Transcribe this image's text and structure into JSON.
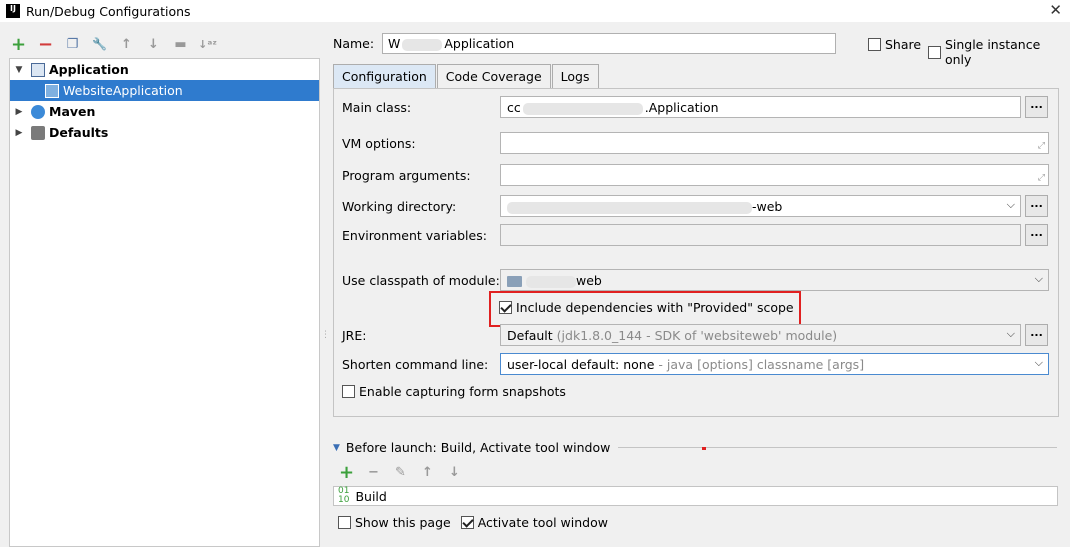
{
  "window": {
    "title": "Run/Debug Configurations",
    "app_icon_text": "IJ",
    "close_glyph": "✕"
  },
  "left_toolbar": {
    "add": "+",
    "remove": "−",
    "copy": "❐",
    "edit_defaults": "🔧",
    "move_up": "↑",
    "move_down": "↓",
    "folder": "▬",
    "sort": "↓ᵃᶻ"
  },
  "tree": {
    "items": [
      {
        "label": "Application",
        "expanded": true
      },
      {
        "label": "WebsiteApplication",
        "selected": true
      },
      {
        "label": "Maven",
        "expanded": false
      },
      {
        "label": "Defaults",
        "expanded": false
      }
    ]
  },
  "header": {
    "name_label": "Name:",
    "name_prefix": "W",
    "name_suffix": "Application",
    "share_label": "Share",
    "single_instance_label": "Single instance only"
  },
  "tabs": [
    {
      "label": "Configuration",
      "active": true
    },
    {
      "label": "Code Coverage"
    },
    {
      "label": "Logs"
    }
  ],
  "config": {
    "main_class_label": "Main class:",
    "main_class_prefix": "cc",
    "main_class_suffix": ".Application",
    "vm_options_label": "VM options:",
    "program_args_label": "Program arguments:",
    "working_dir_label": "Working directory:",
    "working_dir_suffix": "-web",
    "env_vars_label": "Environment variables:",
    "classpath_label": "Use classpath of module:",
    "classpath_value": "web",
    "include_deps_label": "Include dependencies with \"Provided\" scope",
    "jre_label": "JRE:",
    "jre_value": "Default",
    "jre_hint": "(jdk1.8.0_144 - SDK of 'websiteweb' module)",
    "shorten_label": "Shorten command line:",
    "shorten_value": "user-local default: none",
    "shorten_hint": "- java [options] classname [args]",
    "snapshots_label": "Enable capturing form snapshots",
    "dots": "...",
    "dropdown_glyph": "⌵",
    "expand_glyph": "⤢"
  },
  "before_launch": {
    "title": "Before launch: Build, Activate tool window",
    "toolbar": {
      "add": "+",
      "remove": "−",
      "edit": "✎",
      "up": "↑",
      "down": "↓"
    },
    "task": "Build",
    "task_icon": "01\n10",
    "show_page_label": "Show this page",
    "activate_tool_label": "Activate tool window"
  }
}
